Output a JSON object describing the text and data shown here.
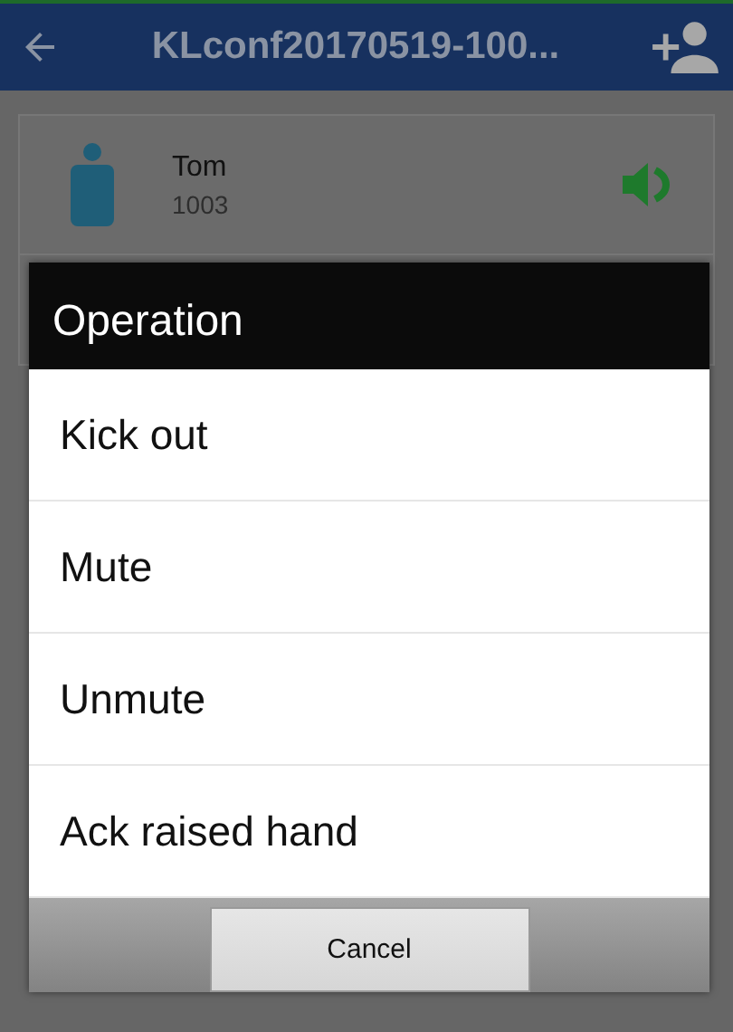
{
  "app_bar": {
    "title": "KLconf20170519-100..."
  },
  "participants": [
    {
      "name": "Tom",
      "number": "1003",
      "speaking": true
    }
  ],
  "dialog": {
    "title": "Operation",
    "options": [
      "Kick out",
      "Mute",
      "Unmute",
      "Ack raised hand"
    ],
    "button": "Cancel"
  }
}
